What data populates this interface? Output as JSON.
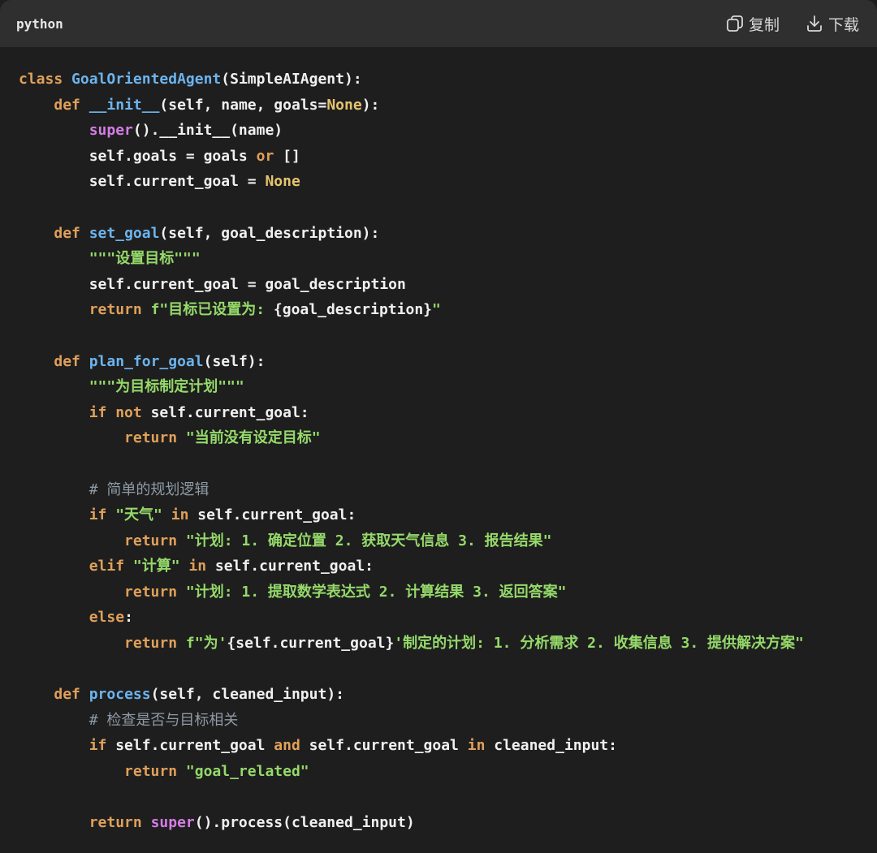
{
  "header": {
    "language": "python",
    "copy_label": "复制",
    "download_label": "下载"
  },
  "code_lines": [
    [
      {
        "t": "class ",
        "c": "kw"
      },
      {
        "t": "GoalOrientedAgent",
        "c": "fn"
      },
      {
        "t": "(SimpleAIAgent):",
        "c": ""
      }
    ],
    [
      {
        "t": "    ",
        "c": ""
      },
      {
        "t": "def ",
        "c": "kw"
      },
      {
        "t": "__init__",
        "c": "fn"
      },
      {
        "t": "(self, name, goals=",
        "c": ""
      },
      {
        "t": "None",
        "c": "cn"
      },
      {
        "t": "):",
        "c": ""
      }
    ],
    [
      {
        "t": "        ",
        "c": ""
      },
      {
        "t": "super",
        "c": "bi"
      },
      {
        "t": "().__init__(name)",
        "c": ""
      }
    ],
    [
      {
        "t": "        self.goals = goals ",
        "c": ""
      },
      {
        "t": "or",
        "c": "kw"
      },
      {
        "t": " []",
        "c": ""
      }
    ],
    [
      {
        "t": "        self.current_goal = ",
        "c": ""
      },
      {
        "t": "None",
        "c": "cn"
      }
    ],
    [],
    [
      {
        "t": "    ",
        "c": ""
      },
      {
        "t": "def ",
        "c": "kw"
      },
      {
        "t": "set_goal",
        "c": "fn"
      },
      {
        "t": "(self, goal_description):",
        "c": ""
      }
    ],
    [
      {
        "t": "        ",
        "c": ""
      },
      {
        "t": "\"\"\"设置目标\"\"\"",
        "c": "st"
      }
    ],
    [
      {
        "t": "        self.current_goal = goal_description",
        "c": ""
      }
    ],
    [
      {
        "t": "        ",
        "c": ""
      },
      {
        "t": "return ",
        "c": "kw"
      },
      {
        "t": "f\"目标已设置为: ",
        "c": "st"
      },
      {
        "t": "{goal_description}",
        "c": ""
      },
      {
        "t": "\"",
        "c": "st"
      }
    ],
    [],
    [
      {
        "t": "    ",
        "c": ""
      },
      {
        "t": "def ",
        "c": "kw"
      },
      {
        "t": "plan_for_goal",
        "c": "fn"
      },
      {
        "t": "(self):",
        "c": ""
      }
    ],
    [
      {
        "t": "        ",
        "c": ""
      },
      {
        "t": "\"\"\"为目标制定计划\"\"\"",
        "c": "st"
      }
    ],
    [
      {
        "t": "        ",
        "c": ""
      },
      {
        "t": "if not ",
        "c": "kw"
      },
      {
        "t": "self.current_goal:",
        "c": ""
      }
    ],
    [
      {
        "t": "            ",
        "c": ""
      },
      {
        "t": "return ",
        "c": "kw"
      },
      {
        "t": "\"当前没有设定目标\"",
        "c": "st"
      }
    ],
    [],
    [
      {
        "t": "        ",
        "c": ""
      },
      {
        "t": "# 简单的规划逻辑",
        "c": "cm"
      }
    ],
    [
      {
        "t": "        ",
        "c": ""
      },
      {
        "t": "if ",
        "c": "kw"
      },
      {
        "t": "\"天气\" ",
        "c": "st"
      },
      {
        "t": "in ",
        "c": "kw"
      },
      {
        "t": "self.current_goal:",
        "c": ""
      }
    ],
    [
      {
        "t": "            ",
        "c": ""
      },
      {
        "t": "return ",
        "c": "kw"
      },
      {
        "t": "\"计划: 1. 确定位置 2. 获取天气信息 3. 报告结果\"",
        "c": "st"
      }
    ],
    [
      {
        "t": "        ",
        "c": ""
      },
      {
        "t": "elif ",
        "c": "kw"
      },
      {
        "t": "\"计算\" ",
        "c": "st"
      },
      {
        "t": "in ",
        "c": "kw"
      },
      {
        "t": "self.current_goal:",
        "c": ""
      }
    ],
    [
      {
        "t": "            ",
        "c": ""
      },
      {
        "t": "return ",
        "c": "kw"
      },
      {
        "t": "\"计划: 1. 提取数学表达式 2. 计算结果 3. 返回答案\"",
        "c": "st"
      }
    ],
    [
      {
        "t": "        ",
        "c": ""
      },
      {
        "t": "else",
        "c": "kw"
      },
      {
        "t": ":",
        "c": ""
      }
    ],
    [
      {
        "t": "            ",
        "c": ""
      },
      {
        "t": "return ",
        "c": "kw"
      },
      {
        "t": "f\"为'",
        "c": "st"
      },
      {
        "t": "{self.current_goal}",
        "c": ""
      },
      {
        "t": "'制定的计划: 1. 分析需求 2. 收集信息 3. 提供解决方案\"",
        "c": "st"
      }
    ],
    [],
    [
      {
        "t": "    ",
        "c": ""
      },
      {
        "t": "def ",
        "c": "kw"
      },
      {
        "t": "process",
        "c": "fn"
      },
      {
        "t": "(self, cleaned_input):",
        "c": ""
      }
    ],
    [
      {
        "t": "        ",
        "c": ""
      },
      {
        "t": "# 检查是否与目标相关",
        "c": "cm"
      }
    ],
    [
      {
        "t": "        ",
        "c": ""
      },
      {
        "t": "if ",
        "c": "kw"
      },
      {
        "t": "self.current_goal ",
        "c": ""
      },
      {
        "t": "and ",
        "c": "kw"
      },
      {
        "t": "self.current_goal ",
        "c": ""
      },
      {
        "t": "in ",
        "c": "kw"
      },
      {
        "t": "cleaned_input:",
        "c": ""
      }
    ],
    [
      {
        "t": "            ",
        "c": ""
      },
      {
        "t": "return ",
        "c": "kw"
      },
      {
        "t": "\"goal_related\"",
        "c": "st"
      }
    ],
    [],
    [
      {
        "t": "        ",
        "c": ""
      },
      {
        "t": "return ",
        "c": "kw"
      },
      {
        "t": "super",
        "c": "bi"
      },
      {
        "t": "().process(cleaned_input)",
        "c": ""
      }
    ]
  ]
}
